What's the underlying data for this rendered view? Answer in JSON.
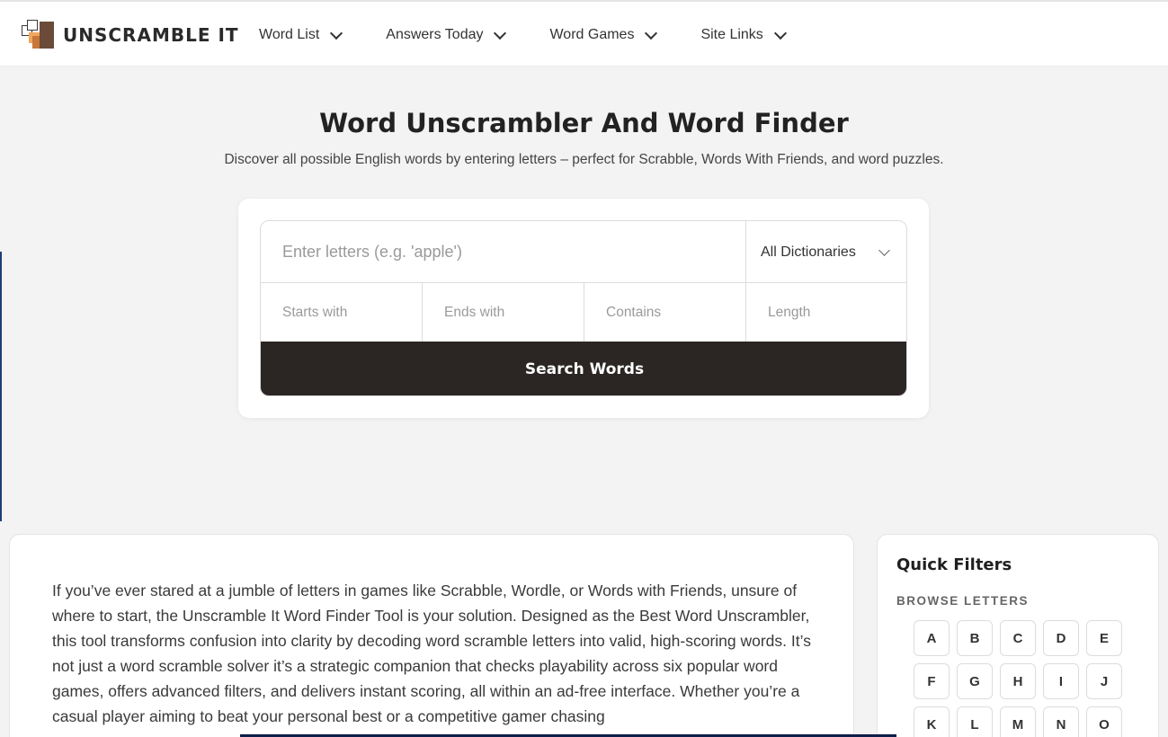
{
  "header": {
    "logo_text": "UNSCRAMBLE IT",
    "nav": [
      {
        "label": "Word List"
      },
      {
        "label": "Answers Today"
      },
      {
        "label": "Word Games"
      },
      {
        "label": "Site Links"
      }
    ]
  },
  "hero": {
    "title": "Word Unscrambler And Word Finder",
    "subtitle": "Discover all possible English words by entering letters – perfect for Scrabble, Words With Friends, and word puzzles."
  },
  "search": {
    "letters_placeholder": "Enter letters (e.g. 'apple')",
    "dictionary_selected": "All Dictionaries",
    "starts_placeholder": "Starts with",
    "ends_placeholder": "Ends with",
    "contains_placeholder": "Contains",
    "length_placeholder": "Length",
    "button_label": "Search Words"
  },
  "article": {
    "text": "If you’ve ever stared at a jumble of letters in games like Scrabble, Wordle, or Words with Friends, unsure of where to start, the Unscramble It Word Finder Tool is your solution. Designed as the Best Word Unscrambler, this tool transforms confusion into clarity by decoding word scramble letters into valid, high-scoring words. It’s not just a word scramble solver it’s a strategic companion that checks playability across six popular word games, offers advanced filters, and delivers instant scoring, all within an ad-free interface. Whether you’re a casual player aiming to beat your personal best or a competitive gamer chasing"
  },
  "quick_filters": {
    "title": "Quick Filters",
    "subtitle": "BROWSE LETTERS",
    "letters": [
      "A",
      "B",
      "C",
      "D",
      "E",
      "F",
      "G",
      "H",
      "I",
      "J",
      "K",
      "L",
      "M",
      "N",
      "O"
    ]
  },
  "colors": {
    "button_bg": "#2b2624",
    "page_bg": "#f3f3f3",
    "logo_orange": "#f2a65a",
    "logo_brown": "#6b4a3a"
  }
}
